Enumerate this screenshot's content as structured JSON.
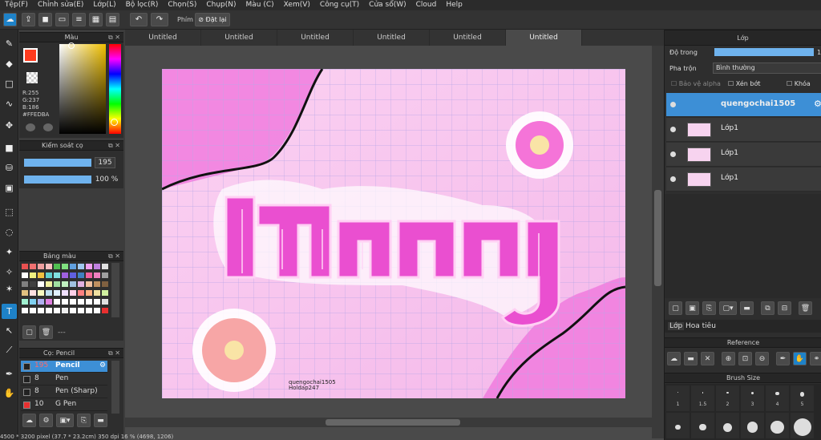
{
  "menu": [
    "Tệp(F)",
    "Chỉnh sửa(E)",
    "Lớp(L)",
    "Bộ lọc(R)",
    "Chọn(S)",
    "Chụp(N)",
    "Màu (C)",
    "Xem(V)",
    "Công cụ(T)",
    "Cửa sổ(W)",
    "Cloud",
    "Help"
  ],
  "toolbar": {
    "phim_label": "Phím",
    "reset_label": "Đặt lại"
  },
  "color_panel": {
    "title": "Màu",
    "r": "R:255",
    "g": "G:237",
    "b": "B:186",
    "hex": "#FFEDBA",
    "fg": "#FF3B1E",
    "bg": "#FFFFFF"
  },
  "brush_control": {
    "title": "Kiểm soát cọ",
    "size": "195",
    "opacity": "100 %"
  },
  "palette": {
    "title": "Bảng màu",
    "footer": "---",
    "colors": [
      "#e85050",
      "#f07070",
      "#f0a0a0",
      "#f8c0c0",
      "#50c050",
      "#80e080",
      "#60a0e0",
      "#a0c8f0",
      "#f0a0f0",
      "#c080e0",
      "#e0e0e0",
      "#ffffff",
      "#f0f080",
      "#f0c040",
      "#60d0d0",
      "#80e0e0",
      "#a060e0",
      "#6060e0",
      "#4080c0",
      "#f060a0",
      "#f080c0",
      "#a0a0a0",
      "#808080",
      "#404040",
      "#ffffff",
      "#f0f0a0",
      "#a0e0a0",
      "#c0f0c0",
      "#a0c0e0",
      "#e0b0e0",
      "#f0c0a0",
      "#c09060",
      "#806040",
      "#e0c080",
      "#ffe0e0",
      "#f8f8c0",
      "#c0e0f0",
      "#e0f0ff",
      "#f0e0ff",
      "#ffd0e8",
      "#ff8080",
      "#ffb080",
      "#f0e0a0",
      "#d0f0a0",
      "#a0f0d0",
      "#80d0f0",
      "#b0b0f0",
      "#e080e0",
      "#ffffff",
      "#ffffff",
      "#ffffff",
      "#ffffff",
      "#ffffff",
      "#ffffff",
      "#e0e0e0",
      "#ffffff",
      "#ffffff",
      "#ffffff",
      "#ffffff",
      "#ffffff",
      "#f0f0f0",
      "#ffffff",
      "#ffffff",
      "#ffffff",
      "#ffffff",
      "#e83030"
    ]
  },
  "brush_list": {
    "title": "Cọ: Pencil",
    "items": [
      {
        "size": "195",
        "name": "Pencil",
        "color": "#222222"
      },
      {
        "size": "8",
        "name": "Pen",
        "color": "#222222"
      },
      {
        "size": "8",
        "name": "Pen (Sharp)",
        "color": "#222222"
      },
      {
        "size": "10",
        "name": "G Pen",
        "color": "#e83030"
      }
    ]
  },
  "tabs": [
    "Untitled",
    "Untitled",
    "Untitled",
    "Untitled",
    "Untitled",
    "Untitled"
  ],
  "canvas": {
    "watermark_line1": "quengochai1505",
    "watermark_line2": "Holdap247"
  },
  "layers": {
    "title": "Lớp",
    "opacity_label": "Độ trong",
    "opacity_value": "1",
    "blend_label": "Pha trộn",
    "blend_value": "Bình thường",
    "protect_alpha": "Bảo vệ alpha",
    "clip": "Xén bớt",
    "lock": "Khóa",
    "items": [
      "quengochai1505",
      "Lớp1",
      "Lớp1",
      "Lớp1"
    ],
    "tab_layer": "Lớp",
    "tab_texture": "Hoa tiêu"
  },
  "reference": {
    "title": "Reference"
  },
  "brush_size": {
    "title": "Brush Size",
    "labels": [
      "1",
      "1.5",
      "2",
      "3",
      "4",
      "5"
    ]
  },
  "status": {
    "text": "4500 * 3200 pixel  (37.7 * 23.2cm)  350 dpi  16 %  (4698, 1206)"
  }
}
